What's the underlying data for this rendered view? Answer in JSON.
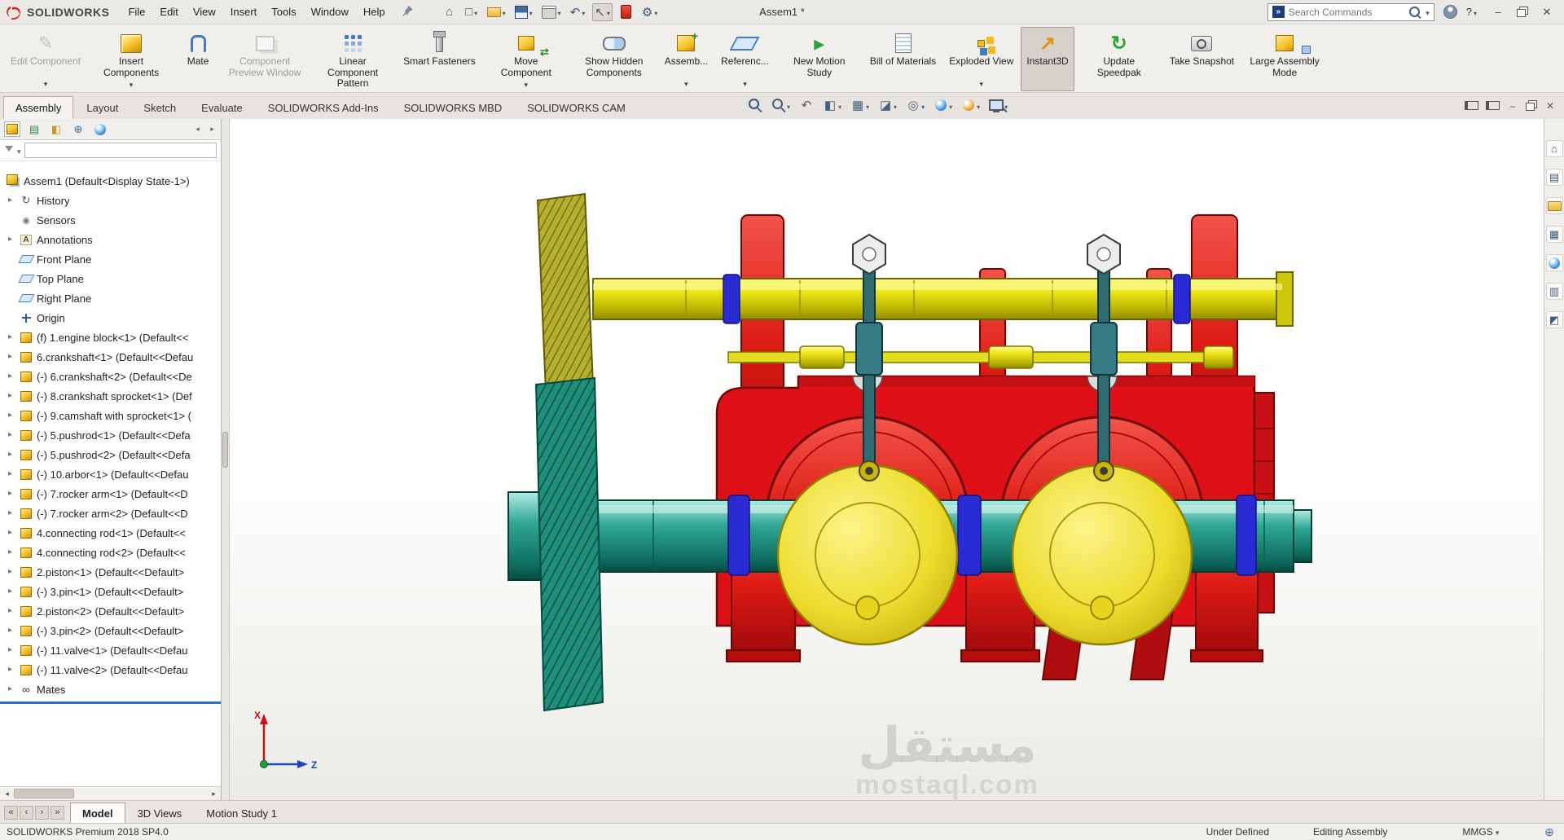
{
  "titlebar": {
    "app_name": "SOLIDWORKS",
    "menus": [
      {
        "label": "File"
      },
      {
        "label": "Edit"
      },
      {
        "label": "View"
      },
      {
        "label": "Insert"
      },
      {
        "label": "Tools"
      },
      {
        "label": "Window"
      },
      {
        "label": "Help"
      }
    ],
    "quick_access": [
      {
        "name": "home-icon",
        "glyph": "⌂",
        "flags": []
      },
      {
        "name": "new-document-icon",
        "glyph": "□",
        "flags": [
          "caret"
        ]
      },
      {
        "name": "open-document-icon",
        "glyph": "",
        "flags": [
          "caret",
          "i-folder"
        ]
      },
      {
        "name": "save-icon",
        "glyph": "",
        "flags": [
          "caret",
          "i-save"
        ]
      },
      {
        "name": "print-icon",
        "glyph": "",
        "flags": [
          "caret",
          "i-print"
        ]
      },
      {
        "name": "undo-icon",
        "glyph": "↶",
        "flags": [
          "caret"
        ]
      },
      {
        "name": "select-tool-icon",
        "glyph": "↖",
        "flags": [
          "caret",
          "pressed"
        ]
      },
      {
        "name": "xpress-products-icon",
        "glyph": "",
        "flags": [
          "i-red"
        ]
      },
      {
        "name": "options-gear-icon",
        "glyph": "⚙",
        "flags": [
          "caret"
        ]
      }
    ],
    "document_title": "Assem1 *",
    "search": {
      "placeholder": "Search Commands"
    },
    "help_label": "?",
    "window_buttons": [
      {
        "name": "minimize-window-icon",
        "glyph": "–",
        "flags": []
      },
      {
        "name": "restore-window-icon",
        "glyph": "",
        "flags": [
          "i-restore"
        ]
      },
      {
        "name": "close-window-icon",
        "glyph": "✕",
        "flags": []
      }
    ]
  },
  "ribbon": {
    "buttons": [
      {
        "label": "Edit Component",
        "icon_name": "edit-component-icon",
        "flags": [
          "i-edit",
          "disabled",
          "dropdown"
        ]
      },
      {
        "label": "Insert Components",
        "icon_name": "insert-components-icon",
        "flags": [
          "i-cube",
          "dropdown"
        ]
      },
      {
        "label": "Mate",
        "icon_name": "mate-icon",
        "flags": [
          "i-clip"
        ]
      },
      {
        "label": "Component Preview Window",
        "icon_name": "component-preview-window-icon",
        "flags": [
          "i-preview",
          "disabled"
        ]
      },
      {
        "label": "Linear Component Pattern",
        "icon_name": "linear-component-pattern-icon",
        "flags": [
          "i-pattern",
          "dropdown"
        ]
      },
      {
        "label": "Smart Fasteners",
        "icon_name": "smart-fasteners-icon",
        "flags": [
          "i-fast"
        ]
      },
      {
        "label": "Move Component",
        "icon_name": "move-component-icon",
        "flags": [
          "i-move",
          "dropdown"
        ]
      },
      {
        "label": "Show Hidden Components",
        "icon_name": "show-hidden-components-icon",
        "flags": [
          "i-ghost"
        ]
      },
      {
        "label": "Assemb...",
        "icon_name": "assembly-features-icon",
        "flags": [
          "i-asmfeat",
          "dropdown"
        ]
      },
      {
        "label": "Referenc...",
        "icon_name": "reference-geometry-icon",
        "flags": [
          "i-ref",
          "dropdown"
        ]
      },
      {
        "label": "New Motion Study",
        "icon_name": "new-motion-study-icon",
        "flags": [
          "i-motion"
        ]
      },
      {
        "label": "Bill of Materials",
        "icon_name": "bill-of-materials-icon",
        "flags": [
          "i-bom"
        ]
      },
      {
        "label": "Exploded View",
        "icon_name": "exploded-view-icon",
        "flags": [
          "i-expl",
          "dropdown"
        ]
      },
      {
        "label": "Instant3D",
        "icon_name": "instant3d-icon",
        "flags": [
          "i-i3d",
          "active"
        ]
      },
      {
        "label": "Update Speedpak",
        "icon_name": "update-speedpak-icon",
        "flags": [
          "i-speed"
        ]
      },
      {
        "label": "Take Snapshot",
        "icon_name": "take-snapshot-icon",
        "flags": [
          "i-snap"
        ]
      },
      {
        "label": "Large Assembly Mode",
        "icon_name": "large-assembly-mode-icon",
        "flags": [
          "i-lam"
        ]
      }
    ]
  },
  "tabs": [
    {
      "label": "Assembly",
      "flags": [
        "active"
      ]
    },
    {
      "label": "Layout",
      "flags": []
    },
    {
      "label": "Sketch",
      "flags": []
    },
    {
      "label": "Evaluate",
      "flags": []
    },
    {
      "label": "SOLIDWORKS Add-Ins",
      "flags": []
    },
    {
      "label": "SOLIDWORKS MBD",
      "flags": []
    },
    {
      "label": "SOLIDWORKS CAM",
      "flags": []
    }
  ],
  "headsup": [
    {
      "name": "zoom-fit-icon",
      "glyph": "",
      "flags": [
        "i-mag"
      ]
    },
    {
      "name": "zoom-area-icon",
      "glyph": "",
      "flags": [
        "i-mag",
        "caret"
      ]
    },
    {
      "name": "previous-view-icon",
      "glyph": "↶",
      "flags": []
    },
    {
      "name": "section-view-icon",
      "glyph": "◧",
      "flags": [
        "caret"
      ]
    },
    {
      "name": "view-orientation-icon",
      "glyph": "▦",
      "flags": [
        "caret"
      ]
    },
    {
      "name": "display-style-icon",
      "glyph": "◪",
      "flags": [
        "caret"
      ]
    },
    {
      "name": "hide-show-items-icon",
      "glyph": "◎",
      "flags": [
        "caret"
      ]
    },
    {
      "name": "edit-appearance-icon",
      "glyph": "",
      "flags": [
        "i-ball",
        "caret"
      ]
    },
    {
      "name": "apply-scene-icon",
      "glyph": "",
      "flags": [
        "i-ball2",
        "caret"
      ]
    },
    {
      "name": "view-settings-icon",
      "glyph": "",
      "flags": [
        "i-monitor",
        "caret"
      ]
    }
  ],
  "docwin": [
    {
      "name": "undock-panel-icon",
      "glyph": "",
      "flags": [
        "i-pane"
      ]
    },
    {
      "name": "task-pane-toggle-icon",
      "glyph": "",
      "flags": [
        "i-pane"
      ]
    },
    {
      "name": "minimize-document-icon",
      "glyph": "–",
      "flags": []
    },
    {
      "name": "restore-document-icon",
      "glyph": "",
      "flags": [
        "i-restore"
      ]
    },
    {
      "name": "close-document-icon",
      "glyph": "✕",
      "flags": []
    }
  ],
  "panel_tabs": [
    {
      "name": "featuremanager-tree-tab-icon",
      "glyph": "",
      "flags": [
        "i-cube-s",
        "on"
      ]
    },
    {
      "name": "propertymanager-tab-icon",
      "glyph": "▤",
      "flags": [
        "c-grn"
      ]
    },
    {
      "name": "configurationmanager-tab-icon",
      "glyph": "◧",
      "flags": [
        "c-ylw"
      ]
    },
    {
      "name": "dimxpertmanager-tab-icon",
      "glyph": "⊕",
      "flags": [
        "c-blu"
      ]
    },
    {
      "name": "displaymanager-tab-icon",
      "glyph": "",
      "flags": [
        "i-ball"
      ]
    },
    {
      "name": "panel-tab-scroll-left-icon",
      "glyph": "◂",
      "flags": [
        "sm"
      ]
    },
    {
      "name": "panel-tab-scroll-right-icon",
      "glyph": "▸",
      "flags": [
        "sm"
      ]
    }
  ],
  "tree": {
    "root_label": "Assem1 (Default<Display State-1>)",
    "items": [
      {
        "label": "History",
        "flags": [
          "arrow",
          "i-history"
        ]
      },
      {
        "label": "Sensors",
        "flags": [
          "i-sensors"
        ]
      },
      {
        "label": "Annotations",
        "flags": [
          "arrow",
          "i-annot"
        ]
      },
      {
        "label": "Front Plane",
        "flags": [
          "i-plane"
        ]
      },
      {
        "label": "Top Plane",
        "flags": [
          "i-plane"
        ]
      },
      {
        "label": "Right Plane",
        "flags": [
          "i-plane"
        ]
      },
      {
        "label": "Origin",
        "flags": [
          "i-origin"
        ]
      },
      {
        "label": "(f) 1.engine block<1> (Default<<",
        "flags": [
          "arrow",
          "i-part"
        ]
      },
      {
        "label": "6.crankshaft<1> (Default<<Defau",
        "flags": [
          "arrow",
          "i-part"
        ]
      },
      {
        "label": "(-) 6.crankshaft<2> (Default<<De",
        "flags": [
          "arrow",
          "i-part"
        ]
      },
      {
        "label": "(-) 8.crankshaft sprocket<1> (Def",
        "flags": [
          "arrow",
          "i-part"
        ]
      },
      {
        "label": "(-) 9.camshaft with sprocket<1> (",
        "flags": [
          "arrow",
          "i-part"
        ]
      },
      {
        "label": "(-) 5.pushrod<1> (Default<<Defa",
        "flags": [
          "arrow",
          "i-part"
        ]
      },
      {
        "label": "(-) 5.pushrod<2> (Default<<Defa",
        "flags": [
          "arrow",
          "i-part"
        ]
      },
      {
        "label": "(-) 10.arbor<1> (Default<<Defau",
        "flags": [
          "arrow",
          "i-part"
        ]
      },
      {
        "label": "(-) 7.rocker arm<1> (Default<<D",
        "flags": [
          "arrow",
          "i-part"
        ]
      },
      {
        "label": "(-) 7.rocker arm<2> (Default<<D",
        "flags": [
          "arrow",
          "i-part"
        ]
      },
      {
        "label": "4.connecting rod<1> (Default<<",
        "flags": [
          "arrow",
          "i-part"
        ]
      },
      {
        "label": "4.connecting rod<2> (Default<<",
        "flags": [
          "arrow",
          "i-part"
        ]
      },
      {
        "label": "2.piston<1> (Default<<Default>",
        "flags": [
          "arrow",
          "i-part"
        ]
      },
      {
        "label": "(-) 3.pin<1> (Default<<Default>",
        "flags": [
          "arrow",
          "i-part"
        ]
      },
      {
        "label": "2.piston<2> (Default<<Default>",
        "flags": [
          "arrow",
          "i-part"
        ]
      },
      {
        "label": "(-) 3.pin<2> (Default<<Default>",
        "flags": [
          "arrow",
          "i-part"
        ]
      },
      {
        "label": "(-) 11.valve<1> (Default<<Defau",
        "flags": [
          "arrow",
          "i-part"
        ]
      },
      {
        "label": "(-) 11.valve<2> (Default<<Defau",
        "flags": [
          "arrow",
          "i-part"
        ]
      },
      {
        "label": "Mates",
        "flags": [
          "arrow",
          "i-mates"
        ]
      }
    ]
  },
  "rightpane": [
    {
      "name": "solidworks-resources-icon",
      "glyph": "⌂",
      "flags": []
    },
    {
      "name": "design-library-icon",
      "glyph": "▤",
      "flags": []
    },
    {
      "name": "file-explorer-icon",
      "glyph": "",
      "flags": [
        "i-folder"
      ]
    },
    {
      "name": "view-palette-icon",
      "glyph": "▦",
      "flags": []
    },
    {
      "name": "appearances-scenes-icon",
      "glyph": "",
      "flags": [
        "i-ball"
      ]
    },
    {
      "name": "custom-properties-icon",
      "glyph": "▥",
      "flags": []
    },
    {
      "name": "forum-icon",
      "glyph": "◩",
      "flags": []
    }
  ],
  "bottom": {
    "scroll_buttons": [
      {
        "name": "tab-scroll-first-icon",
        "glyph": "«"
      },
      {
        "name": "tab-scroll-prev-icon",
        "glyph": "‹"
      },
      {
        "name": "tab-scroll-next-icon",
        "glyph": "›"
      },
      {
        "name": "tab-scroll-last-icon",
        "glyph": "»"
      }
    ],
    "tabs": [
      {
        "label": "Model",
        "flags": [
          "active"
        ]
      },
      {
        "label": "3D Views",
        "flags": []
      },
      {
        "label": "Motion Study 1",
        "flags": []
      }
    ]
  },
  "statusbar": {
    "left": "SOLIDWORKS Premium 2018 SP4.0",
    "under_defined": "Under Defined",
    "editing": "Editing Assembly",
    "units": "MMGS"
  },
  "viewport": {
    "triad": {
      "x_label": "X",
      "z_label": "Z"
    }
  },
  "watermark": {
    "line1": "مستقل",
    "line2": "mostaql.com"
  },
  "colors": {
    "accent_red": "#d41216",
    "camshaft_yellow": "#e8e227",
    "crankshaft_teal": "#1d8a7c",
    "counterweight_yellow": "#eedc2e",
    "bearing_ring_blue": "#2a2ad4",
    "rollback_bar_blue": "#2a6fd6",
    "instant3d_active_bg": "#d6d2cb"
  }
}
